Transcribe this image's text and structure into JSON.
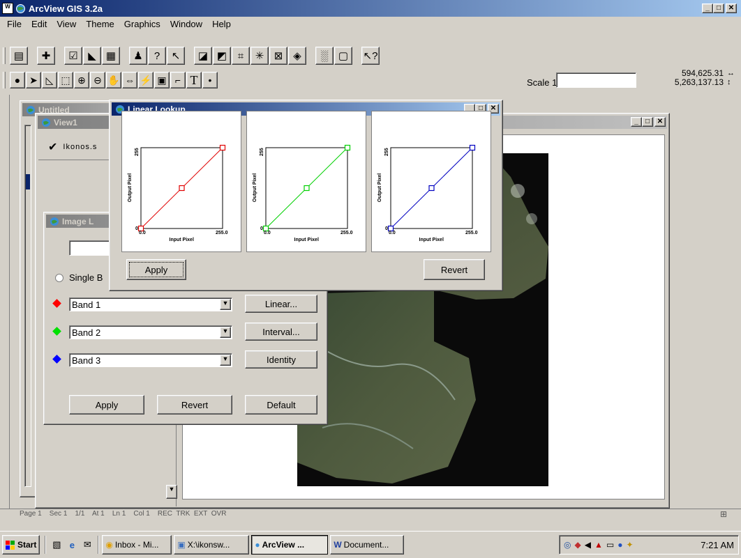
{
  "app": {
    "title": "ArcView GIS 3.2a"
  },
  "menu": [
    "File",
    "Edit",
    "View",
    "Theme",
    "Graphics",
    "Window",
    "Help"
  ],
  "toolbar": {
    "scale_label": "Scale 1:",
    "scale_value": "",
    "coord_x": "594,625.31",
    "coord_y": "5,263,137.13"
  },
  "windows": {
    "untitled": {
      "title": "Untitled"
    },
    "view1": {
      "title": "View1",
      "theme": "Ikonos.s"
    },
    "image_legend": {
      "title": "Image L",
      "single_band_label": "Single B",
      "bands": [
        {
          "value": "Band 1",
          "color": "#ff0000",
          "button": "Linear..."
        },
        {
          "value": "Band 2",
          "color": "#00e000",
          "button": "Interval..."
        },
        {
          "value": "Band 3",
          "color": "#0000ff",
          "button": "Identity"
        }
      ],
      "apply": "Apply",
      "revert": "Revert",
      "default": "Default"
    },
    "linear_lookup": {
      "title": "Linear Lookup",
      "apply": "Apply",
      "revert": "Revert",
      "charts": [
        {
          "color": "#e00000",
          "ylabel": "Output Pixel",
          "xlabel": "Input Pixel",
          "xmin": "0.0",
          "xmax": "255.0",
          "ymin": "0",
          "ymax": "255"
        },
        {
          "color": "#00d000",
          "ylabel": "Output Pixel",
          "xlabel": "Input Pixel",
          "xmin": "0.0",
          "xmax": "255.0",
          "ymin": "0",
          "ymax": "255"
        },
        {
          "color": "#0000c0",
          "ylabel": "Output Pixel",
          "xlabel": "Input Pixel",
          "xmin": "0.0",
          "xmax": "255.0",
          "ymin": "0",
          "ymax": "255"
        }
      ]
    }
  },
  "statusbar": {
    "text": "Page 1    Sec 1    1/1    At 1    Ln 1    Col 1    REC  TRK  EXT  OVR"
  },
  "taskbar": {
    "start": "Start",
    "tasks": [
      {
        "label": "Inbox - Mi...",
        "active": false
      },
      {
        "label": "X:\\ikonsw...",
        "active": false
      },
      {
        "label": "ArcView ...",
        "active": true
      },
      {
        "label": "Document...",
        "active": false
      }
    ],
    "clock": "7:21 AM"
  }
}
